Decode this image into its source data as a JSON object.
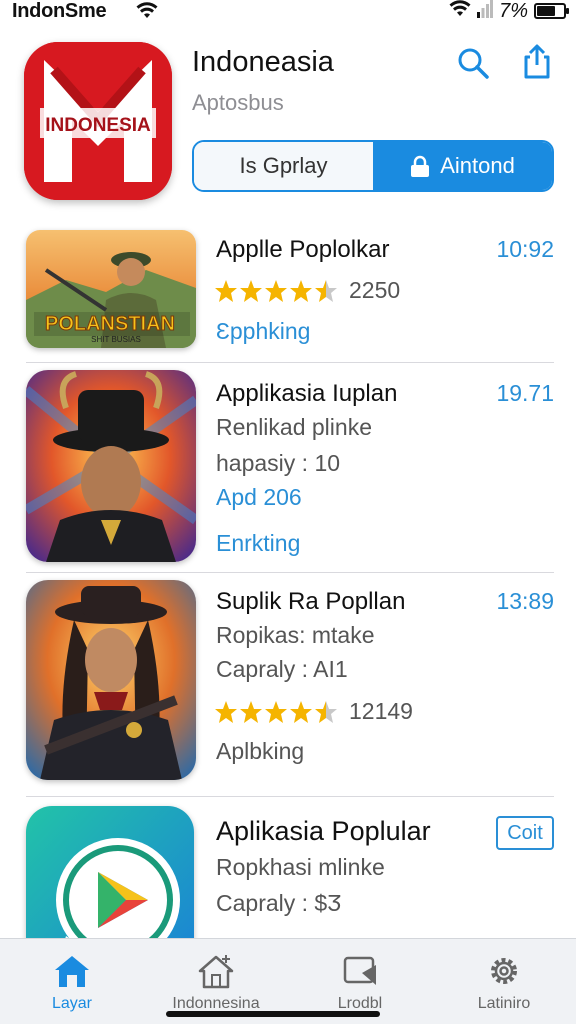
{
  "status_bar": {
    "carrier": "IndonSme",
    "battery_text": "7%",
    "battery_level": 0.7
  },
  "header": {
    "title": "Indoneasia",
    "subtitle": "Aptosbus",
    "icon_text": "INDONESIA",
    "segment_left": "Is Gprlay",
    "segment_right": "Aintond",
    "icons": [
      "search-icon",
      "share-icon",
      "lock-icon"
    ]
  },
  "apps": [
    {
      "title": "Applle Poplolkar",
      "time": "10:92",
      "rating": 4.5,
      "rating_count": "2250",
      "action": "Ɛpphking",
      "thumb_text": "POLANSTIAN",
      "thumb_sub": "SHIT BUSIAS"
    },
    {
      "title": "Applikasia Iuplan",
      "time": "19.71",
      "line1": "Renlikad plinke",
      "line2": "hapasiy : 10",
      "blue1": "Apd 206",
      "action": "Enrkting"
    },
    {
      "title": "Suplik Ra Popllan",
      "time": "13:89",
      "line1": "Ropikas: mtake",
      "line2": "Capraly : AI1",
      "rating": 4.5,
      "rating_count": "12149",
      "action": "Aplbking"
    },
    {
      "title": "Aplikasia Poplular",
      "button": "Coit",
      "line1": "Ropkhasi mlinke",
      "line2": "Capraly : $Ӡ"
    }
  ],
  "tabs": [
    {
      "label": "Layar",
      "icon": "home-icon",
      "active": true
    },
    {
      "label": "Indonnesina",
      "icon": "house-outline-icon",
      "active": false
    },
    {
      "label": "Lrodbl",
      "icon": "media-icon",
      "active": false
    },
    {
      "label": "Latiniro",
      "icon": "gear-icon",
      "active": false
    }
  ],
  "colors": {
    "accent": "#1a8be0",
    "star": "#f5b400",
    "brand_red": "#d71920"
  }
}
